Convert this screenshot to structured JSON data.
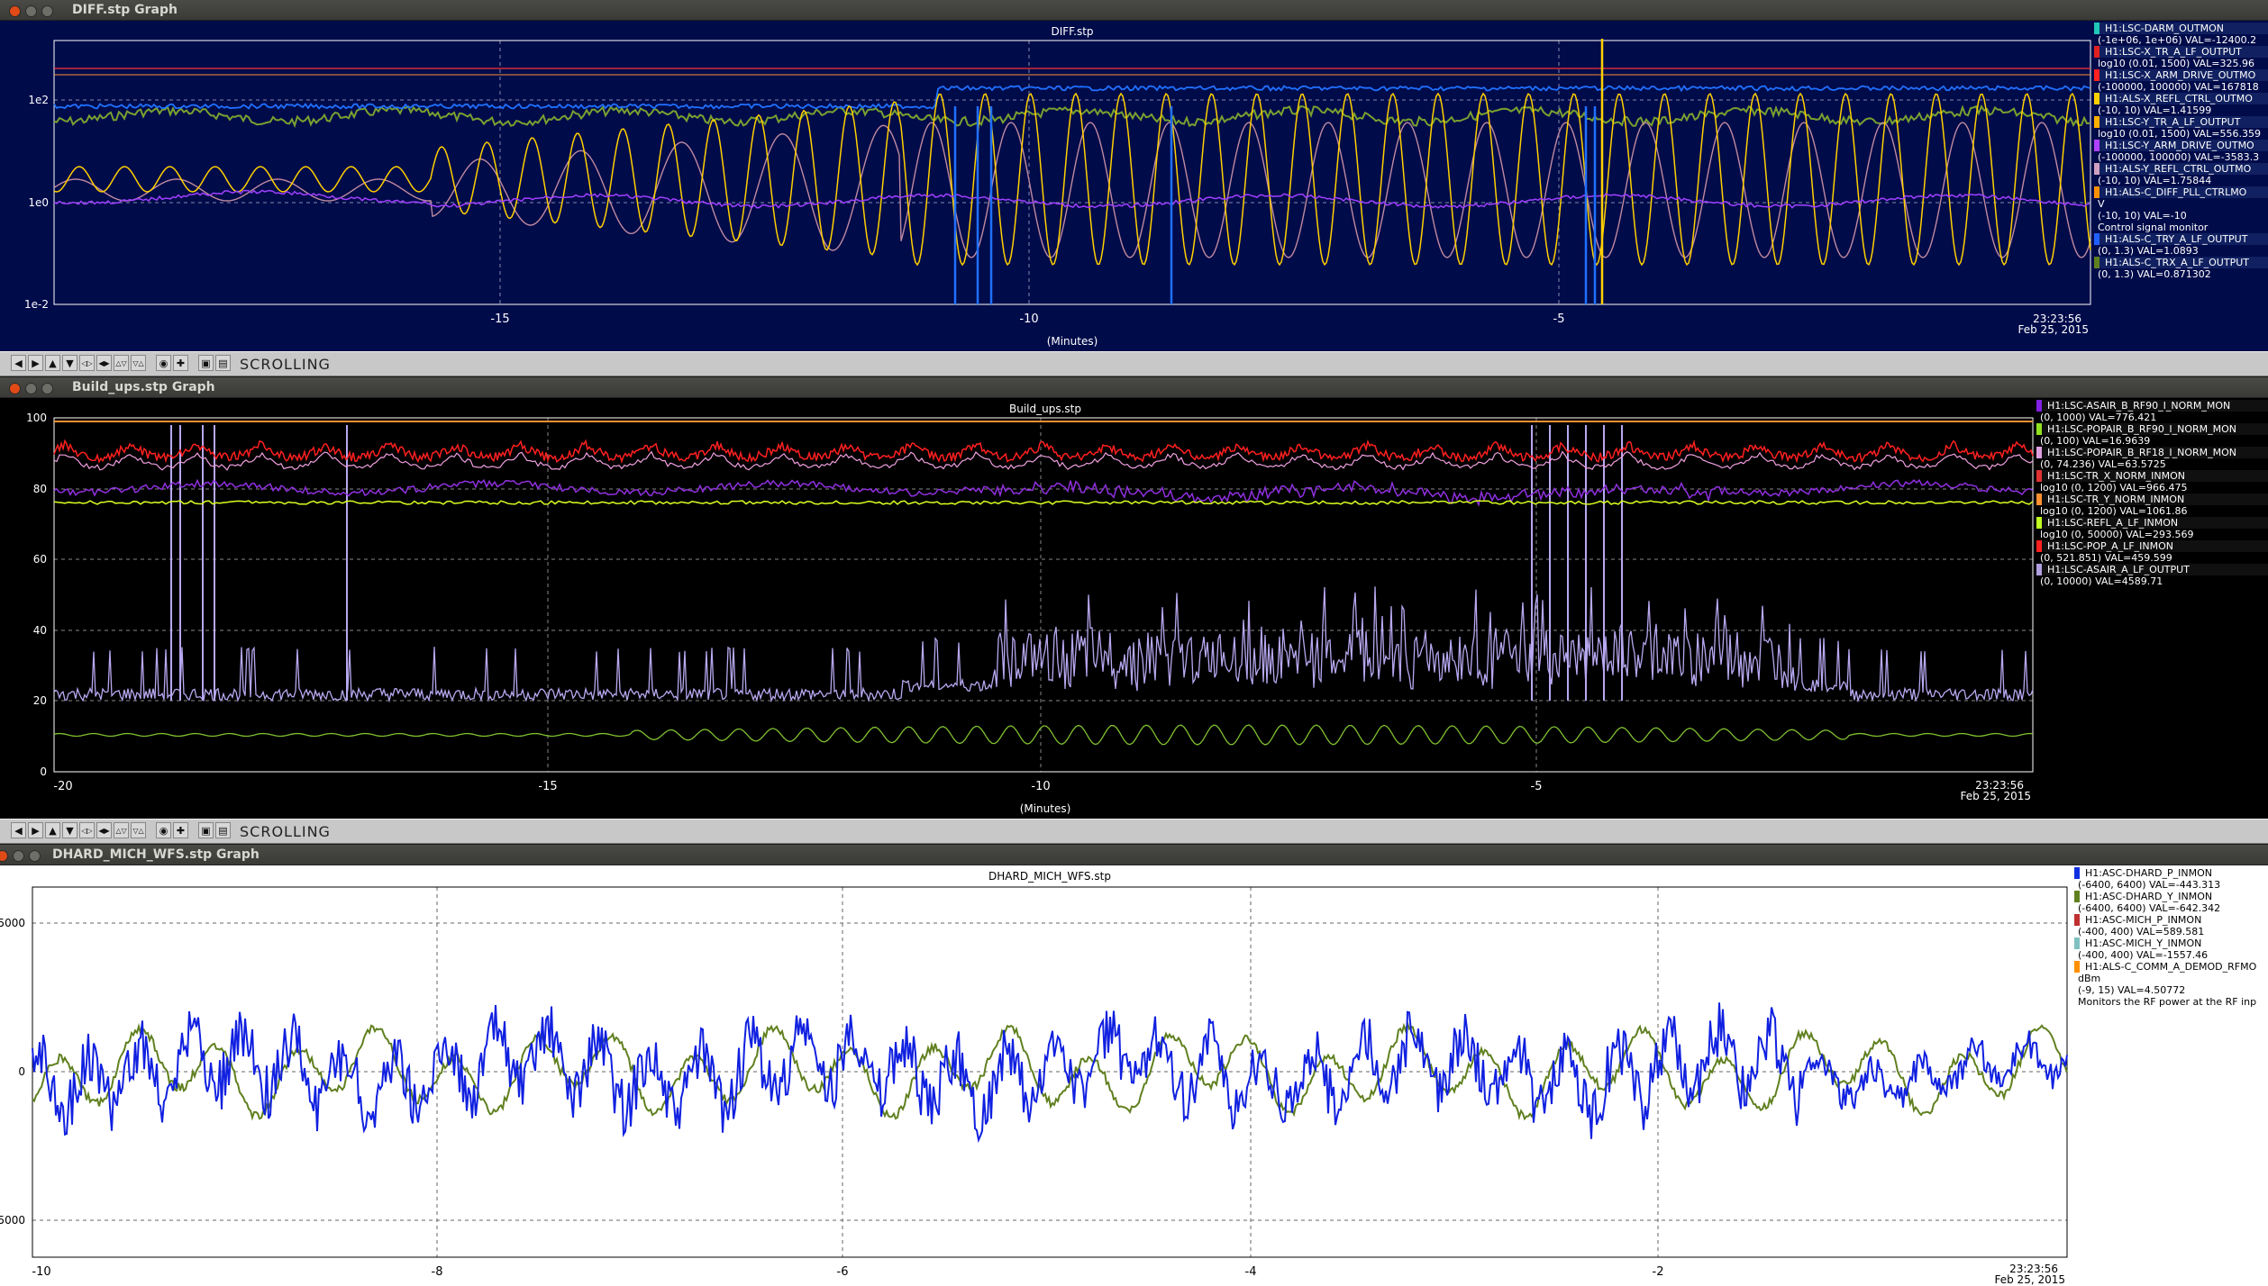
{
  "windows": [
    {
      "id": "diff",
      "title": "DIFF.stp Graph",
      "plot_title": "DIFF.stp",
      "x_ticks": [
        "-15",
        "-10",
        "-5"
      ],
      "y_ticks": [
        "1e2",
        "1e0",
        "1e-2"
      ],
      "xlabel": "(Minutes)",
      "time_label": "23:23:56",
      "date_label": "Feb 25, 2015",
      "toolbar_label": "SCROLLING",
      "legend": [
        {
          "name": "H1:LSC-DARM_OUTMON",
          "range": "(-1e+06, 1e+06) VAL=-12400.2",
          "color": "#1fc8b8"
        },
        {
          "name": "H1:LSC-X_TR_A_LF_OUTPUT",
          "range": "log10 (0.01, 1500) VAL=325.96",
          "color": "#e02020"
        },
        {
          "name": "H1:LSC-X_ARM_DRIVE_OUTMO",
          "range": "(-100000, 100000) VAL=167818",
          "color": "#ff2020"
        },
        {
          "name": "H1:ALS-X_REFL_CTRL_OUTMO",
          "range": "(-10, 10) VAL=1.41599",
          "color": "#ffd000"
        },
        {
          "name": "H1:LSC-Y_TR_A_LF_OUTPUT",
          "range": "log10 (0.01, 1500) VAL=556.359",
          "color": "#ffb000"
        },
        {
          "name": "H1:LSC-Y_ARM_DRIVE_OUTMO",
          "range": "(-100000, 100000) VAL=-3583.3",
          "color": "#b040ff"
        },
        {
          "name": "H1:ALS-Y_REFL_CTRL_OUTMO",
          "range": "(-10, 10) VAL=1.75844",
          "color": "#d0a0c0"
        },
        {
          "name": "H1:ALS-C_DIFF_PLL_CTRLMO",
          "range": "V\n(-10, 10) VAL=-10\nControl signal monitor",
          "color": "#ff9000"
        },
        {
          "name": "H1:ALS-C_TRY_A_LF_OUTPUT",
          "range": "(0, 1.3) VAL=1.0893",
          "color": "#2060ff"
        },
        {
          "name": "H1:ALS-C_TRX_A_LF_OUTPUT",
          "range": "(0, 1.3) VAL=0.871302",
          "color": "#608020"
        }
      ]
    },
    {
      "id": "buildups",
      "title": "Build_ups.stp Graph",
      "plot_title": "Build_ups.stp",
      "x_ticks": [
        "-20",
        "-15",
        "-10",
        "-5"
      ],
      "y_ticks": [
        "100",
        "80",
        "60",
        "40",
        "20",
        "0"
      ],
      "xlabel": "(Minutes)",
      "time_label": "23:23:56",
      "date_label": "Feb 25, 2015",
      "toolbar_label": "SCROLLING",
      "legend": [
        {
          "name": "H1:LSC-ASAIR_B_RF90_I_NORM_MON",
          "range": "(0, 1000) VAL=776.421",
          "color": "#8020e0"
        },
        {
          "name": "H1:LSC-POPAIR_B_RF90_I_NORM_MON",
          "range": "(0, 100) VAL=16.9639",
          "color": "#90e020"
        },
        {
          "name": "H1:LSC-POPAIR_B_RF18_I_NORM_MON",
          "range": "(0, 74.236) VAL=63.5725",
          "color": "#e0a0e0"
        },
        {
          "name": "H1:LSC-TR_X_NORM_INMON",
          "range": "log10 (0, 1200) VAL=966.475",
          "color": "#e03030"
        },
        {
          "name": "H1:LSC-TR_Y_NORM_INMON",
          "range": "log10 (0, 1200) VAL=1061.86",
          "color": "#ff9030"
        },
        {
          "name": "H1:LSC-REFL_A_LF_INMON",
          "range": "log10 (0, 50000) VAL=293.569",
          "color": "#c0ff20"
        },
        {
          "name": "H1:LSC-POP_A_LF_INMON",
          "range": "(0, 521.851) VAL=459.599",
          "color": "#ff2020"
        },
        {
          "name": "H1:LSC-ASAIR_A_LF_OUTPUT",
          "range": "(0, 10000) VAL=4589.71",
          "color": "#b0a0e0"
        }
      ]
    },
    {
      "id": "dhard",
      "title": "DHARD_MICH_WFS.stp Graph",
      "plot_title": "DHARD_MICH_WFS.stp",
      "x_ticks": [
        "-10",
        "-8",
        "-6",
        "-4",
        "-2"
      ],
      "y_ticks": [
        "5000",
        "0",
        "5000"
      ],
      "time_label": "23:23:56",
      "date_label": "Feb 25, 2015",
      "legend": [
        {
          "name": "H1:ASC-DHARD_P_INMON",
          "range": "(-6400, 6400) VAL=-443.313",
          "color": "#1030e0"
        },
        {
          "name": "H1:ASC-DHARD_Y_INMON",
          "range": "(-6400, 6400) VAL=-642.342",
          "color": "#608020"
        },
        {
          "name": "H1:ASC-MICH_P_INMON",
          "range": "(-400, 400) VAL=589.581",
          "color": "#c03030"
        },
        {
          "name": "H1:ASC-MICH_Y_INMON",
          "range": "(-400, 400) VAL=-1557.46",
          "color": "#80c0c0"
        },
        {
          "name": "H1:ALS-C_COMM_A_DEMOD_RFMO",
          "range": "dBm\n(-9, 15) VAL=4.50772\nMonitors the RF power at the RF inp",
          "color": "#ff9000"
        }
      ]
    }
  ]
}
